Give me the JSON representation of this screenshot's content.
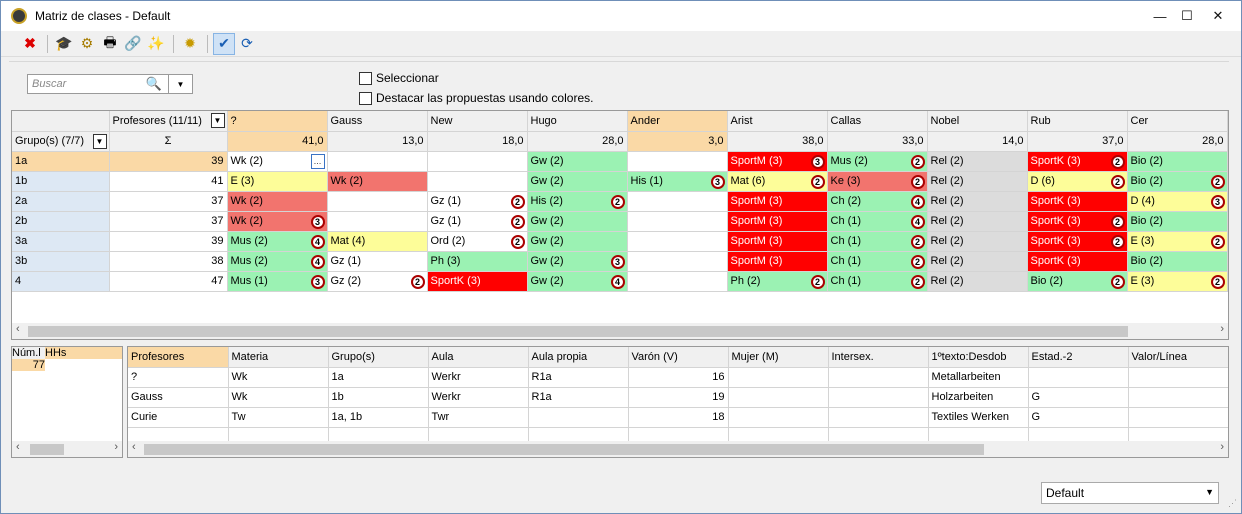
{
  "window": {
    "title": "Matriz de clases - Default",
    "minimize": "—",
    "maximize": "☐",
    "close": "✕"
  },
  "toolbar": {
    "icons": [
      "delete-icon",
      "hat-icon",
      "gear-coin-icon",
      "print-icon",
      "link-icon",
      "wand-icon",
      "settings-icon",
      "check-wand-icon",
      "refresh-icon"
    ]
  },
  "filter": {
    "search_placeholder": "Buscar",
    "select_label": "Seleccionar",
    "highlight_label": "Destacar las propuestas usando colores."
  },
  "matrix": {
    "teachers_header": "Profesores (11/11)",
    "groups_header": "Grupo(s) (7/7)",
    "sigma": "Σ",
    "teachers": [
      "?",
      "Gauss",
      "New",
      "Hugo",
      "Ander",
      "Arist",
      "Callas",
      "Nobel",
      "Rub",
      "Cer"
    ],
    "teacher_totals": [
      "41,0",
      "13,0",
      "18,0",
      "28,0",
      "3,0",
      "38,0",
      "33,0",
      "14,0",
      "37,0",
      "28,0"
    ],
    "rows": [
      {
        "group": "1a",
        "total": "39",
        "cells": [
          [
            "Wk (2)",
            "w",
            ""
          ],
          [
            "",
            "w",
            ""
          ],
          [
            "",
            "w",
            ""
          ],
          [
            "Gw (2)",
            "g",
            ""
          ],
          [
            "",
            "w",
            ""
          ],
          [
            "SportM (3)",
            "R",
            "3"
          ],
          [
            "Mus (2)",
            "g",
            "2"
          ],
          [
            "Rel (2)",
            "gr",
            ""
          ],
          [
            "SportK (3)",
            "R",
            "2"
          ],
          [
            "Bio (2)",
            "g",
            ""
          ]
        ]
      },
      {
        "group": "1b",
        "total": "41",
        "cells": [
          [
            "E (3)",
            "y",
            ""
          ],
          [
            "Wk (2)",
            "r",
            ""
          ],
          [
            "",
            "w",
            ""
          ],
          [
            "Gw (2)",
            "g",
            ""
          ],
          [
            "His (1)",
            "g",
            "3"
          ],
          [
            "Mat (6)",
            "y",
            "2"
          ],
          [
            "Ke (3)",
            "r",
            "2"
          ],
          [
            "Rel (2)",
            "gr",
            ""
          ],
          [
            "D (6)",
            "y",
            "2"
          ],
          [
            "Bio (2)",
            "g",
            "2"
          ]
        ]
      },
      {
        "group": "2a",
        "total": "37",
        "cells": [
          [
            "Wk (2)",
            "r",
            ""
          ],
          [
            "",
            "w",
            ""
          ],
          [
            "Gz (1)",
            "w",
            "2"
          ],
          [
            "His (2)",
            "g",
            "2"
          ],
          [
            "",
            "w",
            ""
          ],
          [
            "SportM (3)",
            "R",
            ""
          ],
          [
            "Ch (2)",
            "g",
            "4"
          ],
          [
            "Rel (2)",
            "gr",
            ""
          ],
          [
            "SportK (3)",
            "R",
            ""
          ],
          [
            "D (4)",
            "y",
            "3"
          ]
        ]
      },
      {
        "group": "2b",
        "total": "37",
        "cells": [
          [
            "Wk (2)",
            "r",
            "3"
          ],
          [
            "",
            "w",
            ""
          ],
          [
            "Gz (1)",
            "w",
            "2"
          ],
          [
            "Gw (2)",
            "g",
            ""
          ],
          [
            "",
            "w",
            ""
          ],
          [
            "SportM (3)",
            "R",
            ""
          ],
          [
            "Ch (1)",
            "g",
            "4"
          ],
          [
            "Rel (2)",
            "gr",
            ""
          ],
          [
            "SportK (3)",
            "R",
            "2"
          ],
          [
            "Bio (2)",
            "g",
            ""
          ]
        ]
      },
      {
        "group": "3a",
        "total": "39",
        "cells": [
          [
            "Mus (2)",
            "g",
            "4"
          ],
          [
            "Mat (4)",
            "y",
            ""
          ],
          [
            "Ord (2)",
            "w",
            "2"
          ],
          [
            "Gw (2)",
            "g",
            ""
          ],
          [
            "",
            "w",
            ""
          ],
          [
            "SportM (3)",
            "R",
            ""
          ],
          [
            "Ch (1)",
            "g",
            "2"
          ],
          [
            "Rel (2)",
            "gr",
            ""
          ],
          [
            "SportK (3)",
            "R",
            "2"
          ],
          [
            "E (3)",
            "y",
            "2"
          ]
        ]
      },
      {
        "group": "3b",
        "total": "38",
        "cells": [
          [
            "Mus (2)",
            "g",
            "4"
          ],
          [
            "Gz (1)",
            "w",
            ""
          ],
          [
            "Ph (3)",
            "g",
            ""
          ],
          [
            "Gw (2)",
            "g",
            "3"
          ],
          [
            "",
            "w",
            ""
          ],
          [
            "SportM (3)",
            "R",
            ""
          ],
          [
            "Ch (1)",
            "g",
            "2"
          ],
          [
            "Rel (2)",
            "gr",
            ""
          ],
          [
            "SportK (3)",
            "R",
            ""
          ],
          [
            "Bio (2)",
            "g",
            ""
          ]
        ]
      },
      {
        "group": "4",
        "total": "47",
        "cells": [
          [
            "Mus (1)",
            "g",
            "3"
          ],
          [
            "Gz (2)",
            "w",
            "2"
          ],
          [
            "SportK (3)",
            "R",
            ""
          ],
          [
            "Gw (2)",
            "g",
            "4"
          ],
          [
            "",
            "w",
            ""
          ],
          [
            "Ph (2)",
            "g",
            "2"
          ],
          [
            "Ch (1)",
            "g",
            "2"
          ],
          [
            "Rel (2)",
            "gr",
            ""
          ],
          [
            "Bio (2)",
            "g",
            "2"
          ],
          [
            "E (3)",
            "y",
            "2"
          ]
        ]
      }
    ]
  },
  "summary": {
    "headers": [
      "Núm.l",
      "HHs"
    ],
    "value": "77"
  },
  "details": {
    "headers": [
      "Profesores",
      "Materia",
      "Grupo(s)",
      "Aula",
      "Aula propia",
      "Varón (V)",
      "Mujer (M)",
      "Intersex.",
      "1ºtexto:Desdob",
      "Estad.-2",
      "Valor/Línea"
    ],
    "rows": [
      [
        "?",
        "Wk",
        "1a",
        "Werkr",
        "R1a",
        "16",
        "",
        "",
        "Metallarbeiten",
        "",
        ""
      ],
      [
        "Gauss",
        "Wk",
        "1b",
        "Werkr",
        "R1a",
        "19",
        "",
        "",
        "Holzarbeiten",
        "G",
        ""
      ],
      [
        "Curie",
        "Tw",
        "1a, 1b",
        "Twr",
        "",
        "18",
        "",
        "",
        "Textiles Werken",
        "G",
        ""
      ]
    ]
  },
  "footer": {
    "selected_view": "Default"
  }
}
